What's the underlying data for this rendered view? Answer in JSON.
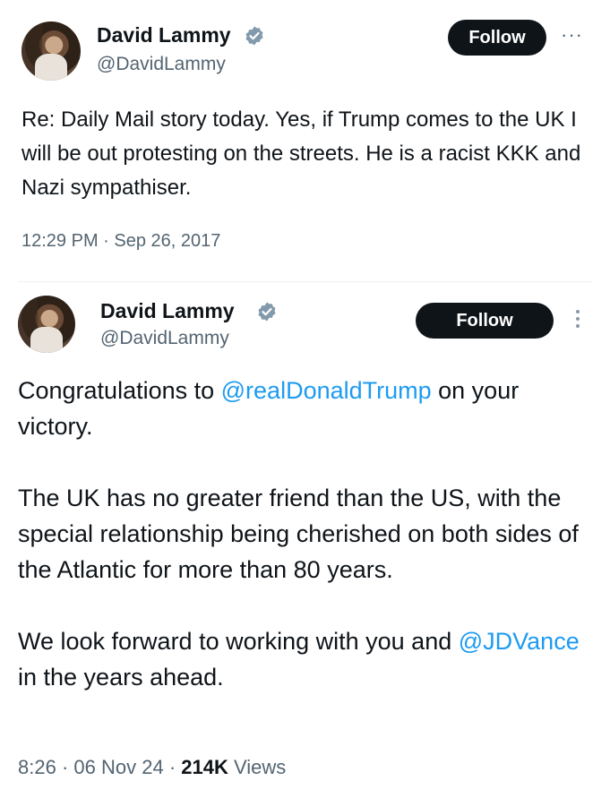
{
  "tweet1": {
    "name": "David Lammy",
    "handle": "@DavidLammy",
    "follow_label": "Follow",
    "more_label": "···",
    "text": "Re: Daily Mail story today. Yes, if Trump comes to the UK I will be out protesting on the streets. He is a racist KKK and Nazi sympathiser.",
    "timestamp": "12:29 PM · Sep 26, 2017"
  },
  "tweet2": {
    "name": "David Lammy",
    "handle": "@DavidLammy",
    "follow_label": "Follow",
    "para1_pre": "Congratulations to ",
    "para1_mention": "@realDonaldTrump",
    "para1_post": " on your victory.",
    "para2": "The UK has no greater friend than the US, with the special relationship being cherished on both sides of the Atlantic for more than 80 years.",
    "para3_pre": "We look forward to working with you and ",
    "para3_mention": "@JDVance",
    "para3_post": " in the years ahead.",
    "time": "8:26",
    "date": "06 Nov 24",
    "views_count": "214K",
    "views_label": "Views"
  },
  "colors": {
    "link": "#1d9bf0",
    "verified": "#829aab",
    "button": "#0f1419"
  }
}
